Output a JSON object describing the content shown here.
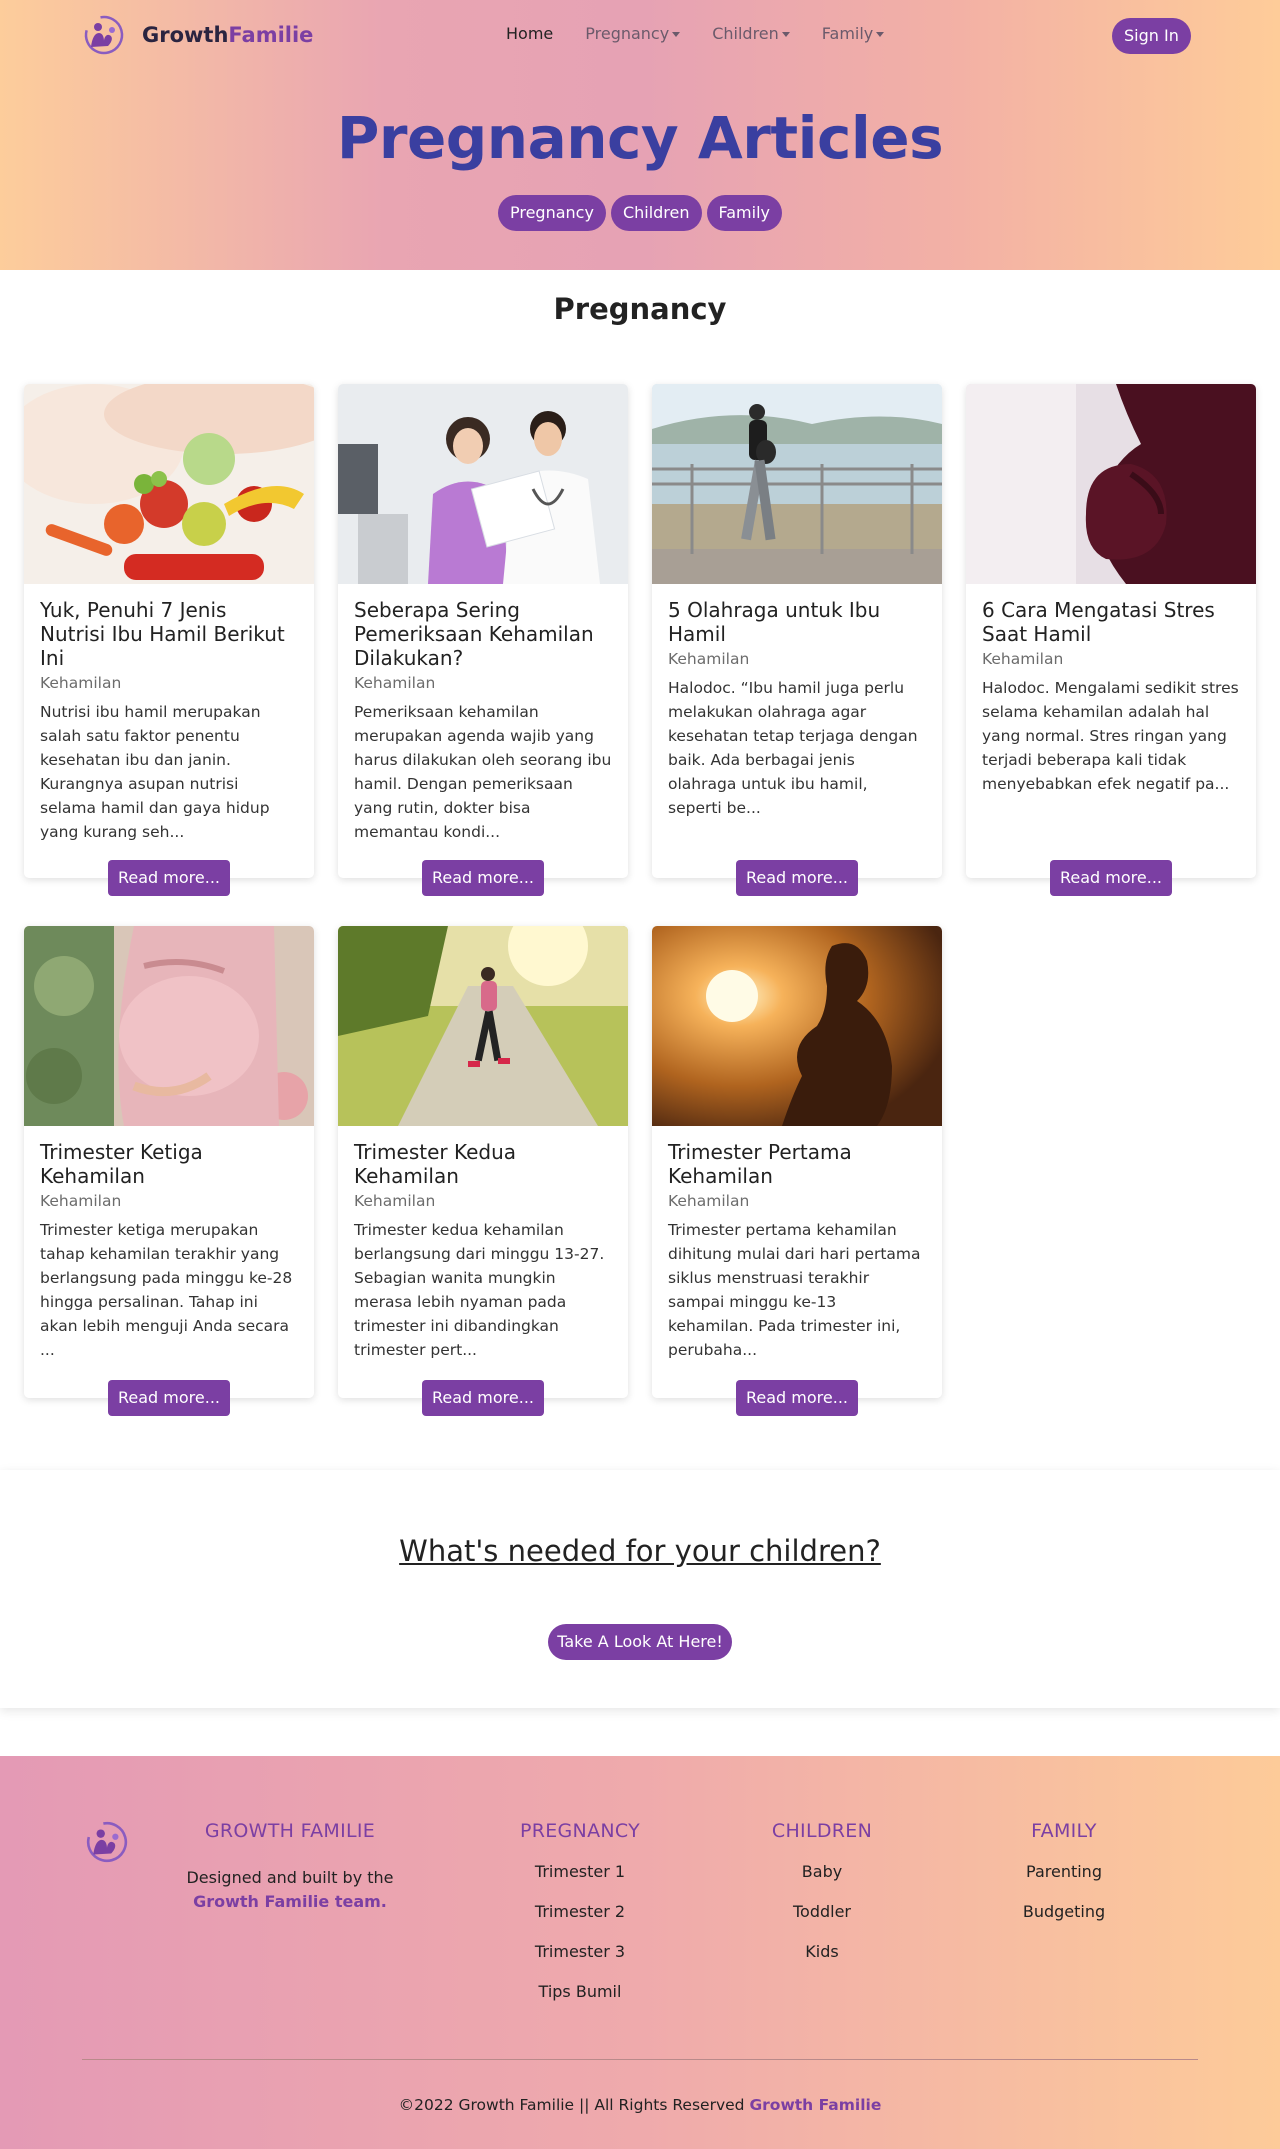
{
  "brand": {
    "name_part1": "Growth",
    "name_part2": "Familie"
  },
  "nav": {
    "home": "Home",
    "pregnancy": "Pregnancy",
    "children": "Children",
    "family": "Family",
    "sign_in": "Sign In"
  },
  "hero": {
    "title": "Pregnancy Articles",
    "pills": [
      "Pregnancy",
      "Children",
      "Family"
    ]
  },
  "section": {
    "title": "Pregnancy"
  },
  "articles": [
    {
      "title": "Yuk, Penuhi 7 Jenis Nutrisi Ibu Hamil Berikut Ini",
      "category": "Kehamilan",
      "excerpt": "Nutrisi ibu hamil merupakan salah satu faktor penentu kesehatan ibu dan janin. Kurangnya asupan nutrisi selama hamil dan gaya hidup yang kurang seh...",
      "read_more": "Read more..."
    },
    {
      "title": "Seberapa Sering Pemeriksaan Kehamilan Dilakukan?",
      "category": "Kehamilan",
      "excerpt": "Pemeriksaan kehamilan merupakan agenda wajib yang harus dilakukan oleh seorang ibu hamil. Dengan pemeriksaan yang rutin, dokter bisa memantau kondi...",
      "read_more": "Read more..."
    },
    {
      "title": "5 Olahraga untuk Ibu Hamil",
      "category": "Kehamilan",
      "excerpt": "Halodoc. “Ibu hamil juga perlu melakukan olahraga agar kesehatan tetap terjaga dengan baik. Ada berbagai jenis olahraga untuk ibu hamil, seperti be...",
      "read_more": "Read more..."
    },
    {
      "title": "6 Cara Mengatasi Stres Saat Hamil",
      "category": "Kehamilan",
      "excerpt": "Halodoc. Mengalami sedikit stres selama kehamilan adalah hal yang normal. Stres ringan yang terjadi beberapa kali tidak menyebabkan efek negatif pa...",
      "read_more": "Read more..."
    },
    {
      "title": "Trimester Ketiga Kehamilan",
      "category": "Kehamilan",
      "excerpt": "Trimester ketiga merupakan tahap kehamilan terakhir yang berlangsung pada minggu ke-28 hingga persalinan. Tahap ini akan lebih menguji Anda secara ...",
      "read_more": "Read more..."
    },
    {
      "title": "Trimester Kedua Kehamilan",
      "category": "Kehamilan",
      "excerpt": "Trimester kedua kehamilan berlangsung dari minggu 13-27. Sebagian wanita mungkin merasa lebih nyaman pada trimester ini dibandingkan trimester pert...",
      "read_more": "Read more..."
    },
    {
      "title": "Trimester Pertama Kehamilan",
      "category": "Kehamilan",
      "excerpt": "Trimester pertama kehamilan dihitung mulai dari hari pertama siklus menstruasi terakhir sampai minggu ke-13 kehamilan. Pada trimester ini, perubaha...",
      "read_more": "Read more..."
    }
  ],
  "cta": {
    "title": "What's needed for your children?",
    "button": "Take A Look At Here!"
  },
  "footer": {
    "brand_heading": "Growth Familie",
    "brand_desc": "Designed and built by the",
    "brand_link": "Growth Familie team.",
    "columns": [
      {
        "heading": "Pregnancy",
        "items": [
          "Trimester 1",
          "Trimester 2",
          "Trimester 3",
          "Tips Bumil"
        ]
      },
      {
        "heading": "Children",
        "items": [
          "Baby",
          "Toddler",
          "Kids"
        ]
      },
      {
        "heading": "Family",
        "items": [
          "Parenting",
          "Budgeting"
        ]
      }
    ],
    "copyright": "©2022 Growth Familie || All Rights Reserved",
    "copyright_link": "Growth Familie"
  },
  "colors": {
    "accent": "#7b3fa3",
    "title_blue": "#3a3fa0",
    "hero_peach": "#fdcd9b",
    "hero_pink": "#e6a2b4"
  },
  "icons": [
    "brand-logo-icon",
    "caret-down-icon"
  ]
}
